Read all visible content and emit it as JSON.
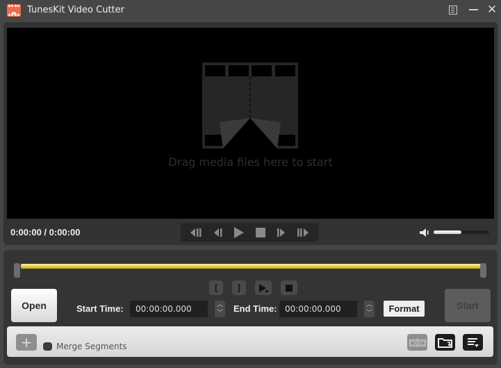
{
  "window": {
    "title": "TunesKit Video Cutter",
    "brand_color": "#f26a4b",
    "controls": [
      "menu-icon",
      "minimize-icon",
      "close-icon"
    ],
    "close_glyph": "✕"
  },
  "player": {
    "drop_hint": "Drag media files here to start",
    "time_readout": "0:00:00 / 0:00:00",
    "transport_buttons": [
      "previous-segment",
      "previous-frame",
      "play",
      "stop",
      "next-frame",
      "next-segment"
    ],
    "volume_level_percent": 50
  },
  "editor": {
    "timeline_color": "#e2c93a",
    "segment_buttons": [
      "set-start-marker",
      "set-end-marker",
      "play-segment",
      "stop-segment"
    ],
    "mark_start_glyph": "[",
    "mark_end_glyph": "]",
    "open_label": "Open",
    "start_time_label": "Start Time:",
    "start_time_value": "00:00:00.000",
    "end_time_label": "End Time:",
    "end_time_value": "00:00:00.000",
    "spinner_up": "︿",
    "spinner_down": "﹀",
    "format_label": "Format",
    "start_label": "Start"
  },
  "bottom_bar": {
    "add_glyph": "+",
    "merge_label": "Merge Segments",
    "merge_checked": false,
    "icons": [
      "subtitle-edit-icon",
      "output-folder-icon",
      "task-list-icon"
    ]
  }
}
